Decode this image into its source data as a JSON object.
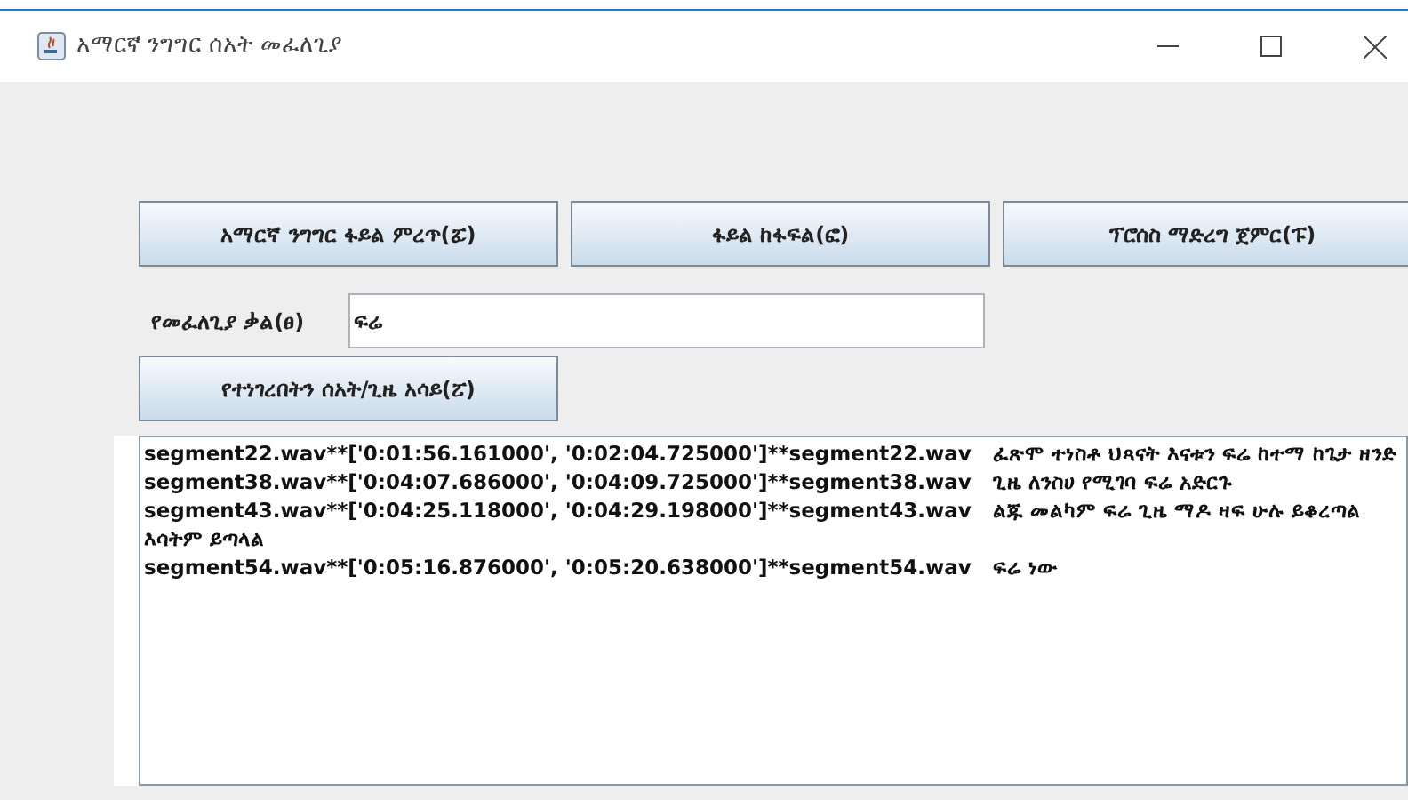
{
  "window": {
    "title": "አማርኛ ንግግር ሰአት መፈለጊያ"
  },
  "buttons": [
    {
      "label": "አማርኛ ንግግር ፋይል ምረጥ(ፚ)"
    },
    {
      "label": "ፋይል ከፋፍል(ፎ)"
    },
    {
      "label": "ፕሮሰስ ማድረግ ጀምር(ፑ)"
    }
  ],
  "search": {
    "label": "የመፈለጊያ ቃል(ፀ)",
    "value": "ፍሬ"
  },
  "show_button": {
    "label": "የተነገረበትን ሰአት/ጊዜ አሳይ(ፘ)"
  },
  "results": [
    "segment22.wav**['0:01:56.161000', '0:02:04.725000']**segment22.wav   ፈጽሞ ተነስቶ ህጻናት እናቱን ፍሬ ከተማ ከጌታ ዘንድ",
    "segment38.wav**['0:04:07.686000', '0:04:09.725000']**segment38.wav   ጊዜ ለንስሀ የሚገባ ፍሬ አድርጉ",
    "segment43.wav**['0:04:25.118000', '0:04:29.198000']**segment43.wav   ልጁ መልካም ፍሬ ጊዜ ማዶ ዛፍ ሁሉ ይቆረጣል እሳትም ይጣላል",
    "segment54.wav**['0:05:16.876000', '0:05:20.638000']**segment54.wav   ፍሬ ነው"
  ]
}
